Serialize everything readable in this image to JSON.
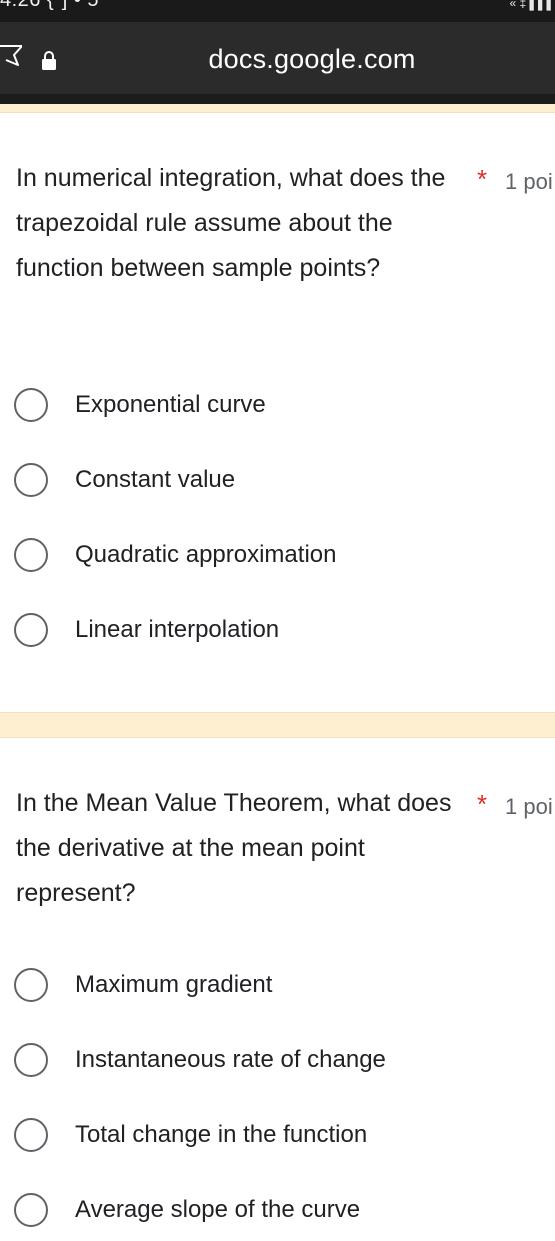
{
  "status_bar": {
    "time": "4:26 {\"] • 5",
    "icons": "« ‡ ▌▌▌"
  },
  "browser": {
    "url": "docs.google.com"
  },
  "questions": [
    {
      "title": "In numerical integration, what does the trapezoidal rule assume about the function between sample points?",
      "required_mark": "*",
      "points": "1 poi",
      "options": [
        "Exponential curve",
        "Constant value",
        "Quadratic approximation",
        "Linear interpolation"
      ]
    },
    {
      "title": "In the Mean Value Theorem, what does the derivative at the mean point represent?",
      "required_mark": "*",
      "points": "1 poi",
      "options": [
        "Maximum gradient",
        "Instantaneous rate of change",
        "Total change in the function",
        "Average slope of the curve"
      ]
    }
  ]
}
